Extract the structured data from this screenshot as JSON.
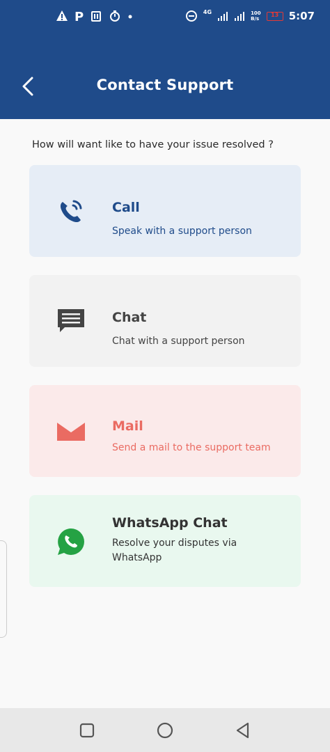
{
  "status_bar": {
    "time": "5:07",
    "network": "4G",
    "speed_value": "100",
    "speed_unit": "B/s",
    "battery": "13",
    "icons": [
      "warning-icon",
      "parking-icon",
      "ticket-icon",
      "timer-icon",
      "dot-icon",
      "dnd-icon",
      "signal-icon",
      "signal-icon",
      "battery-icon"
    ]
  },
  "app_bar": {
    "title": "Contact Support",
    "back_icon": "chevron-left-icon"
  },
  "question": "How will want like to have your issue resolved ?",
  "options": [
    {
      "title": "Call",
      "subtitle": "Speak with a support person",
      "icon": "phone-icon",
      "bg": "#e6edf6",
      "title_color": "#1f4b8a",
      "sub_color": "#1f4b8a"
    },
    {
      "title": "Chat",
      "subtitle": "Chat with a support person",
      "icon": "chat-icon",
      "bg": "#f2f2f2",
      "title_color": "#444444",
      "sub_color": "#444444"
    },
    {
      "title": "Mail",
      "subtitle": "Send a mail to the support team",
      "icon": "mail-icon",
      "bg": "#fbeaea",
      "title_color": "#ea6b62",
      "sub_color": "#ea6b62"
    },
    {
      "title": "WhatsApp Chat",
      "subtitle": "Resolve your disputes via WhatsApp",
      "icon": "whatsapp-icon",
      "bg": "#e9f8ef",
      "title_color": "#333333",
      "sub_color": "#333333"
    }
  ],
  "nav_bar": {
    "icons": [
      "recent-apps-icon",
      "home-icon",
      "back-icon"
    ]
  },
  "colors": {
    "primary": "#1f4b8a",
    "background": "#f9f9f9",
    "mail_accent": "#ea6b62",
    "whatsapp_green": "#25a244"
  }
}
